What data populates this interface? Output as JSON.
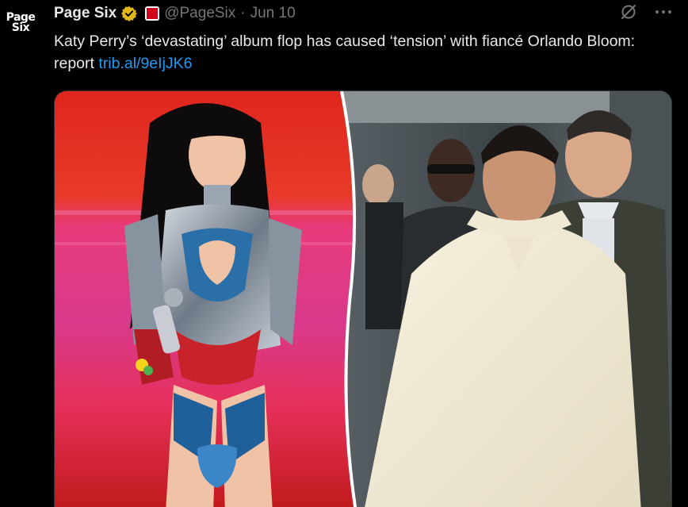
{
  "account": {
    "avatar_line1": "Page",
    "avatar_line2": "Six",
    "display_name": "Page Six",
    "handle": "@PageSix",
    "separator": "·",
    "date": "Jun 10",
    "affiliate_badge_text": "PAGE SIX"
  },
  "tweet": {
    "text_main": "Katy Perry’s ‘devastating’ album flop has caused ‘tension’ with fiancé Orlando Bloom: report ",
    "link_text": "trib.al/9eIjJK6"
  },
  "icons": {
    "verified": "verified-badge-icon",
    "grok": "grok-icon",
    "more": "more-options-icon"
  },
  "colors": {
    "background": "#000000",
    "text": "#e7e9ea",
    "muted": "#71767b",
    "link": "#1d9bf0",
    "verified_gold": "#e2b719",
    "brand_red": "#d0021b"
  }
}
